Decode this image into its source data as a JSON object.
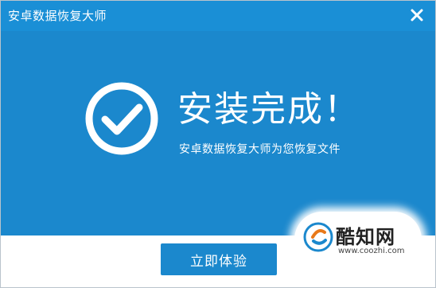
{
  "window": {
    "title": "安卓数据恢复大师"
  },
  "main": {
    "headline": "安装完成！",
    "subtext": "安卓数据恢复大师为您恢复文件"
  },
  "footer": {
    "primary_button": "立即体验"
  },
  "watermark": {
    "name": "酷知网",
    "url": "www.coozhi.com"
  },
  "icons": {
    "close": "close-icon",
    "success": "check-circle-icon",
    "watermark_logo": "coozhi-logo-icon"
  },
  "colors": {
    "title_bar": "#1a8fd6",
    "panel": "#1b88cd",
    "button": "#1b88cd",
    "text_on_blue": "#ffffff"
  }
}
